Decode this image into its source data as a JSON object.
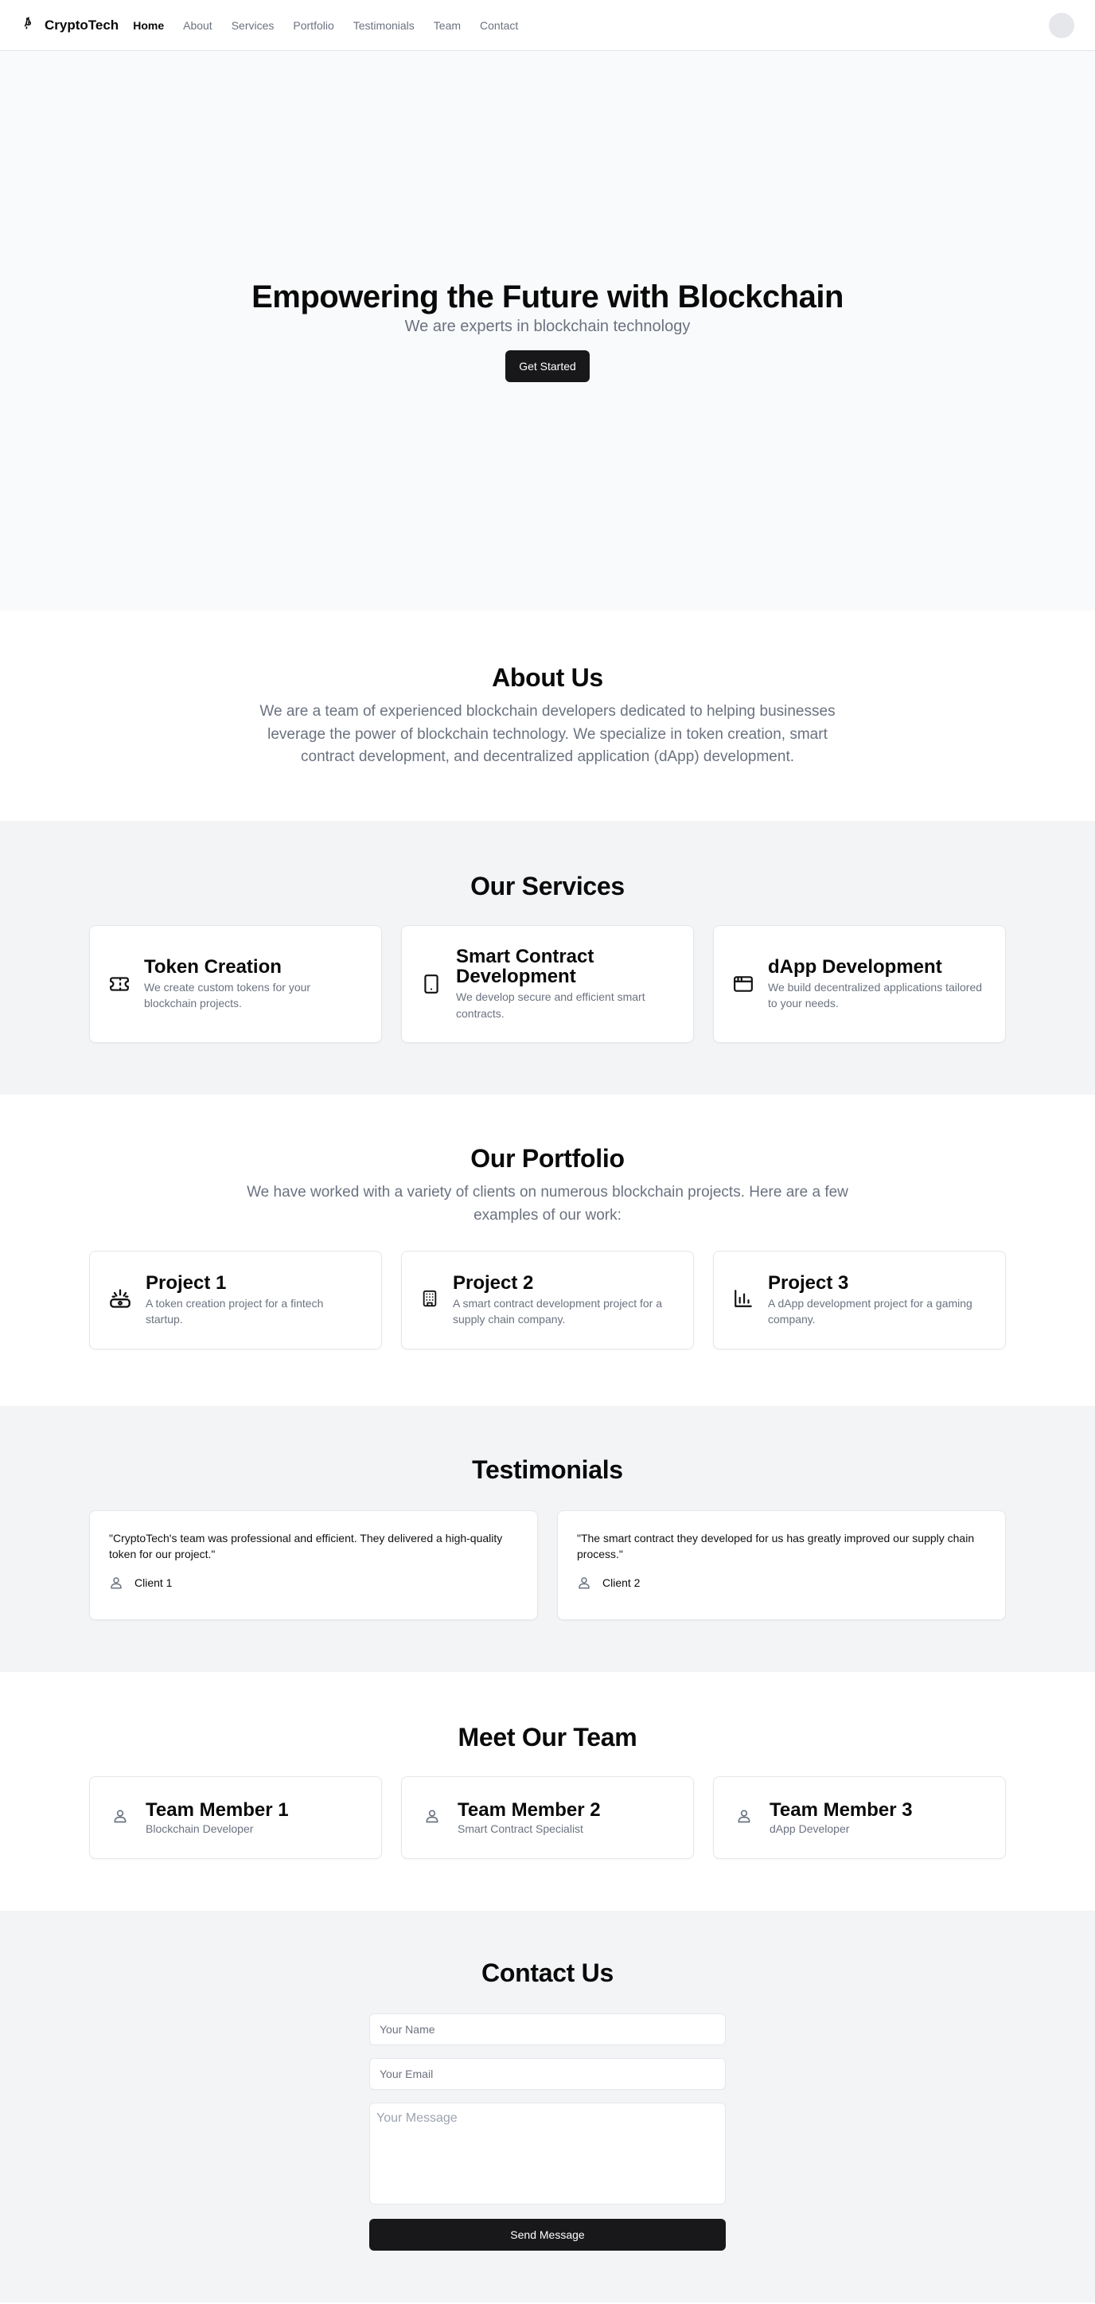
{
  "nav": {
    "brand": "CryptoTech",
    "links": [
      "Home",
      "About",
      "Services",
      "Portfolio",
      "Testimonials",
      "Team",
      "Contact"
    ],
    "active": "Home"
  },
  "hero": {
    "title": "Empowering the Future with Blockchain",
    "subtitle": "We are experts in blockchain technology",
    "cta": "Get Started"
  },
  "about": {
    "title": "About Us",
    "text": "We are a team of experienced blockchain developers dedicated to helping businesses leverage the power of blockchain technology. We specialize in token creation, smart contract development, and decentralized application (dApp) development."
  },
  "services": {
    "title": "Our Services",
    "items": [
      {
        "icon": "ticket-icon",
        "title": "Token Creation",
        "desc": "We create custom tokens for your blockchain projects."
      },
      {
        "icon": "tablet-icon",
        "title": "Smart Contract Development",
        "desc": "We develop secure and efficient smart contracts."
      },
      {
        "icon": "browser-icon",
        "title": "dApp Development",
        "desc": "We build decentralized applications tailored to your needs."
      }
    ]
  },
  "portfolio": {
    "title": "Our Portfolio",
    "text": "We have worked with a variety of clients on numerous blockchain projects. Here are a few examples of our work:",
    "items": [
      {
        "icon": "piggy-bank-icon",
        "title": "Project 1",
        "desc": "A token creation project for a fintech startup."
      },
      {
        "icon": "building-icon",
        "title": "Project 2",
        "desc": "A smart contract development project for a supply chain company."
      },
      {
        "icon": "bar-chart-icon",
        "title": "Project 3",
        "desc": "A dApp development project for a gaming company."
      }
    ]
  },
  "testimonials": {
    "title": "Testimonials",
    "items": [
      {
        "quote": "\"CryptoTech's team was professional and efficient. They delivered a high-quality token for our project.\"",
        "client": "Client 1"
      },
      {
        "quote": "\"The smart contract they developed for us has greatly improved our supply chain process.\"",
        "client": "Client 2"
      }
    ]
  },
  "team": {
    "title": "Meet Our Team",
    "members": [
      {
        "name": "Team Member 1",
        "role": "Blockchain Developer"
      },
      {
        "name": "Team Member 2",
        "role": "Smart Contract Specialist"
      },
      {
        "name": "Team Member 3",
        "role": "dApp Developer"
      }
    ]
  },
  "contact": {
    "title": "Contact Us",
    "name_placeholder": "Your Name",
    "email_placeholder": "Your Email",
    "message_placeholder": "Your Message",
    "submit": "Send Message"
  }
}
